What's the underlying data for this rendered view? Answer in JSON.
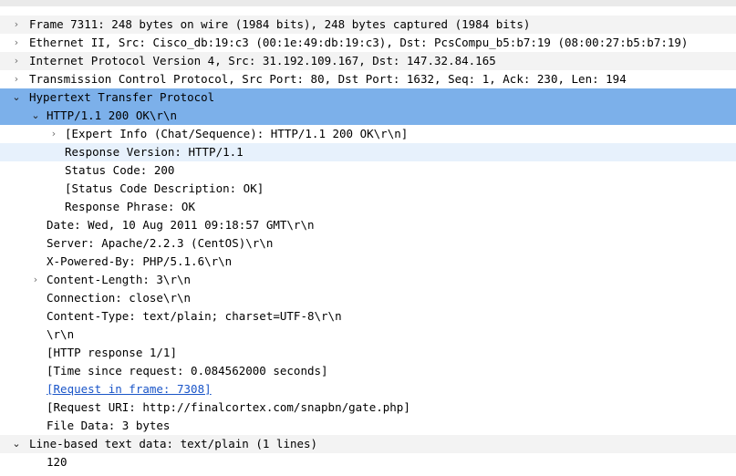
{
  "packet_details": {
    "frame": "Frame 7311: 248 bytes on wire (1984 bits), 248 bytes captured (1984 bits)",
    "ethernet": "Ethernet II, Src: Cisco_db:19:c3 (00:1e:49:db:19:c3), Dst: PcsCompu_b5:b7:19 (08:00:27:b5:b7:19)",
    "ip": "Internet Protocol Version 4, Src: 31.192.109.167, Dst: 147.32.84.165",
    "tcp": "Transmission Control Protocol, Src Port: 80, Dst Port: 1632, Seq: 1, Ack: 230, Len: 194",
    "http": {
      "label": "Hypertext Transfer Protocol",
      "status_line": {
        "label": "HTTP/1.1 200 OK\\r\\n",
        "expert_info": "[Expert Info (Chat/Sequence): HTTP/1.1 200 OK\\r\\n]",
        "response_version": "Response Version: HTTP/1.1",
        "status_code": "Status Code: 200",
        "status_code_description": "[Status Code Description: OK]",
        "response_phrase": "Response Phrase: OK"
      },
      "date": "Date: Wed, 10 Aug 2011 09:18:57 GMT\\r\\n",
      "server": "Server: Apache/2.2.3 (CentOS)\\r\\n",
      "x_powered_by": "X-Powered-By: PHP/5.1.6\\r\\n",
      "content_length": "Content-Length: 3\\r\\n",
      "connection": "Connection: close\\r\\n",
      "content_type": "Content-Type: text/plain; charset=UTF-8\\r\\n",
      "crlf": "\\r\\n",
      "http_response": "[HTTP response 1/1]",
      "time_since_request": "[Time since request: 0.084562000 seconds]",
      "request_in_frame": "[Request in frame: 7308]",
      "request_uri": "[Request URI: http://finalcortex.com/snapbn/gate.php]",
      "file_data": "File Data: 3 bytes"
    },
    "line_based": {
      "label": "Line-based text data: text/plain (1 lines)",
      "value": "120"
    }
  },
  "icons": {
    "collapsed": "chevron-right-icon",
    "expanded": "chevron-down-icon"
  },
  "colors": {
    "selected_row": "#7cb0ea",
    "hover_row": "#e7f1fc",
    "alt_row": "#f3f3f3",
    "link": "#1a55c8"
  }
}
